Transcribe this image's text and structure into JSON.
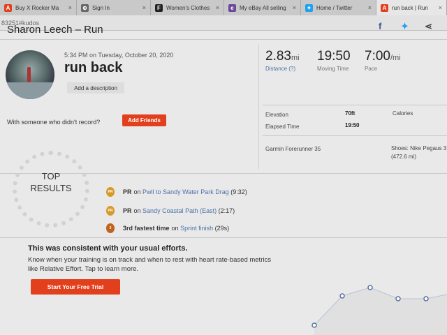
{
  "tabs": [
    {
      "label": "Buy X Rocker Ma",
      "fav_icon": "amazon-icon",
      "fav_color": "#e2401c",
      "fav_glyph": "A"
    },
    {
      "label": "Sign In",
      "fav_icon": "globe-icon",
      "fav_color": "#666666",
      "fav_glyph": "⊕"
    },
    {
      "label": "Women's Clothes",
      "fav_icon": "f-icon",
      "fav_color": "#222222",
      "fav_glyph": "F"
    },
    {
      "label": "My eBay All selling",
      "fav_icon": "ebay-icon",
      "fav_color": "#6a4b9a",
      "fav_glyph": "e"
    },
    {
      "label": "Home / Twitter",
      "fav_icon": "twitter-icon",
      "fav_color": "#1da1f2",
      "fav_glyph": "✦"
    },
    {
      "label": "run back | Run",
      "fav_icon": "strava-icon",
      "fav_color": "#e2401c",
      "fav_glyph": "A"
    }
  ],
  "url": "83251#kudos",
  "activity": {
    "title": "Sharon Leech – Run",
    "date": "5:34 PM on Tuesday, October 20, 2020",
    "name": "run back",
    "add_description": "Add a description",
    "someone_text": "With someone who didn't record?",
    "add_friends": "Add Friends"
  },
  "share_icons": [
    "facebook-icon",
    "twitter-icon",
    "share-icon"
  ],
  "stats": {
    "distance": {
      "value": "2.83",
      "unit": "mi",
      "label": "Distance (?)"
    },
    "moving_time": {
      "value": "19:50",
      "label": "Moving Time"
    },
    "pace": {
      "value": "7:00",
      "unit": "/mi",
      "label": "Pace"
    },
    "elevation_label": "Elevation",
    "elevation_value": "70ft",
    "calories_label": "Calories",
    "elapsed_label": "Elapsed Time",
    "elapsed_value": "19:50",
    "device": "Garmin Forerunner 35",
    "shoes": "Shoes: Nike Pegaus 3",
    "shoes_miles": "(472.6 mi)"
  },
  "top_results": {
    "heading_line1": "TOP",
    "heading_line2": "RESULTS",
    "items": [
      {
        "medal": "pr-medal-icon",
        "glyph": "PR",
        "bold": "PR",
        "mid": "on",
        "link": "Pwll to Sandy Water Park Drag",
        "time": "(9:32)"
      },
      {
        "medal": "pr-medal-icon",
        "glyph": "PR",
        "bold": "PR",
        "mid": "on",
        "link": "Sandy Coastal Path (East)",
        "time": "(2:17)"
      },
      {
        "medal": "bronze-medal-icon",
        "glyph": "3",
        "bold": "3rd fastest time",
        "mid": "on",
        "link": "Sprint finish",
        "time": "(29s)"
      }
    ]
  },
  "promo": {
    "heading": "This was consistent with your usual efforts.",
    "text": "Know when your training is on track and when to rest with heart rate-based metrics like Relative Effort. Tap to learn more.",
    "button": "Start Your Free Trial"
  },
  "colors": {
    "accent": "#e2401c",
    "link": "#4a73a7"
  }
}
